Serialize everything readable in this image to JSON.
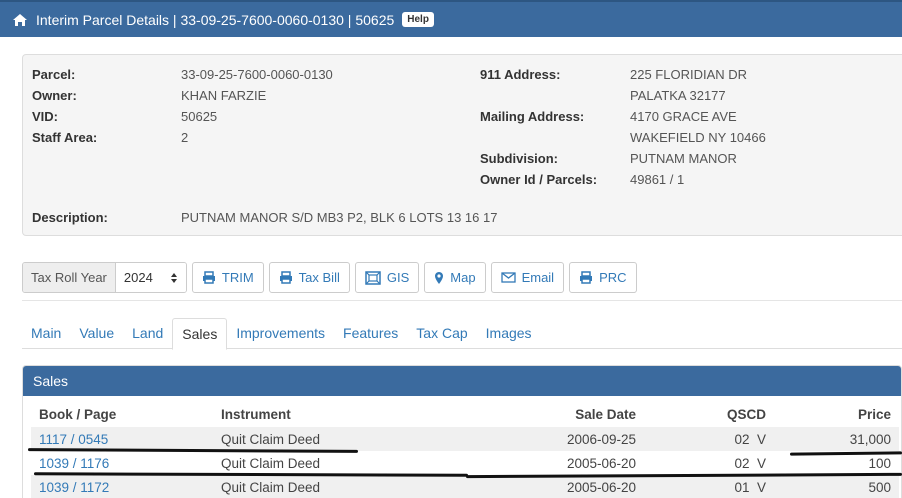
{
  "header": {
    "title": "Interim Parcel Details | 33-09-25-7600-0060-0130 | 50625",
    "help_label": "Help"
  },
  "info": {
    "parcel_label": "Parcel:",
    "parcel_value": "33-09-25-7600-0060-0130",
    "owner_label": "Owner:",
    "owner_value": "KHAN FARZIE",
    "vid_label": "VID:",
    "vid_value": "50625",
    "staff_label": "Staff Area:",
    "staff_value": "2",
    "address911_label": "911 Address:",
    "address911_line1": "225 FLORIDIAN DR",
    "address911_line2": "PALATKA 32177",
    "mailing_label": "Mailing Address:",
    "mailing_line1": "4170 GRACE AVE",
    "mailing_line2": "WAKEFIELD NY 10466",
    "subdivision_label": "Subdivision:",
    "subdivision_value": "PUTNAM MANOR",
    "ownerid_label": "Owner Id / Parcels:",
    "ownerid_value": "49861 / 1",
    "description_label": "Description:",
    "description_value": "PUTNAM MANOR S/D MB3 P2, BLK 6 LOTS 13 16 17"
  },
  "toolbar": {
    "year_label": "Tax Roll Year",
    "year_value": "2024",
    "trim": "TRIM",
    "tax_bill": "Tax Bill",
    "gis": "GIS",
    "map": "Map",
    "email": "Email",
    "prc": "PRC"
  },
  "tabs": [
    "Main",
    "Value",
    "Land",
    "Sales",
    "Improvements",
    "Features",
    "Tax Cap",
    "Images"
  ],
  "sales": {
    "title": "Sales",
    "headers": {
      "book": "Book / Page",
      "instrument": "Instrument",
      "date": "Sale Date",
      "qscd": "QSCD",
      "price": "Price"
    },
    "rows": [
      {
        "book": "1117 / 0545",
        "instrument": "Quit Claim Deed",
        "date": "2006-09-25",
        "qscd": "02  V",
        "price": "31,000"
      },
      {
        "book": "1039 / 1176",
        "instrument": "Quit Claim Deed",
        "date": "2005-06-20",
        "qscd": "02  V",
        "price": "100"
      },
      {
        "book": "1039 / 1172",
        "instrument": "Quit Claim Deed",
        "date": "2005-06-20",
        "qscd": "01  V",
        "price": "500"
      }
    ]
  },
  "colors": {
    "header_bg": "#3b6a9e",
    "link": "#337ab7"
  }
}
